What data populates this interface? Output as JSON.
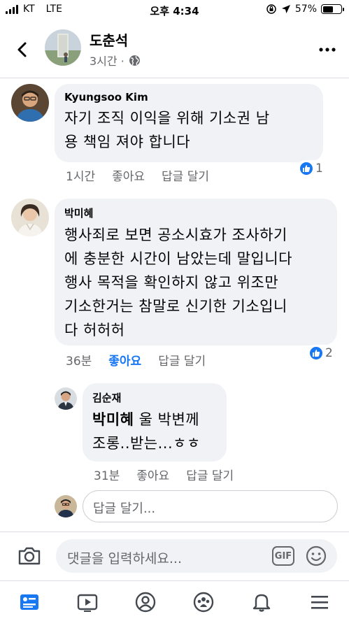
{
  "status_bar": {
    "carrier": "KT",
    "network": "LTE",
    "time": "오후 4:34",
    "battery_text": "57%",
    "battery_level": 0.57
  },
  "header": {
    "name": "도춘석",
    "meta": "3시간 ·"
  },
  "comments": [
    {
      "author": "Kyungsoo Kim",
      "text": "자기 조직 이익을 위해   기소권   남\n용 책임 져야  합니다",
      "time": "1시간",
      "like_label": "좋아요",
      "reply_label": "답글 달기",
      "reaction_count": "1"
    },
    {
      "author": "박미혜",
      "text": "행사죄로 보면 공소시효가 조사하기\n에 충분한 시간이 남았는데 말입니다\n행사 목적을 확인하지 않고 위조만\n기소한거는 참말로 신기한 기소입니\n다 허허허",
      "time": "36분",
      "like_label": "좋아요",
      "reply_label": "답글 달기",
      "reaction_count": "2"
    }
  ],
  "reply": {
    "author": "김순재",
    "mention": "박미혜",
    "text_after_mention": " 울 박변께",
    "text_line2": "조롱..받는...ㅎㅎ",
    "time": "31분",
    "like_label": "좋아요",
    "reply_label": "답글 달기"
  },
  "reply_input": {
    "placeholder": "답글 달기..."
  },
  "composer": {
    "placeholder": "댓글을 입력하세요...",
    "gif_label": "GIF"
  },
  "colors": {
    "accent": "#1877f2",
    "bubble": "#f0f2f5",
    "secondary_text": "#65676b"
  },
  "icons": [
    "back-icon",
    "globe-icon",
    "more-icon",
    "like-icon",
    "camera-icon",
    "emoji-icon",
    "news-feed-icon",
    "watch-icon",
    "profile-icon",
    "groups-icon",
    "bell-icon",
    "menu-icon"
  ]
}
